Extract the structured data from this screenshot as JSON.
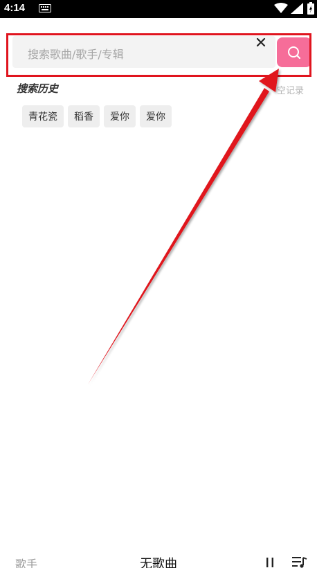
{
  "status_bar": {
    "time": "4:14",
    "icons": [
      "keyboard-icon",
      "wifi-icon",
      "signal-icon",
      "battery-icon"
    ]
  },
  "search": {
    "placeholder": "搜索歌曲/歌手/专辑",
    "clear_icon": "close-icon",
    "button_icon": "search-icon",
    "button_color": "#f66d99"
  },
  "history": {
    "title": "搜索历史",
    "clear_label": "空记录",
    "tags": [
      "青花瓷",
      "稻香",
      "爱你",
      "爱你"
    ]
  },
  "player": {
    "artist": "歌手",
    "song": "无歌曲",
    "icons": [
      "pause-icon",
      "playlist-icon"
    ]
  },
  "annotation": {
    "color": "#e0141e"
  }
}
